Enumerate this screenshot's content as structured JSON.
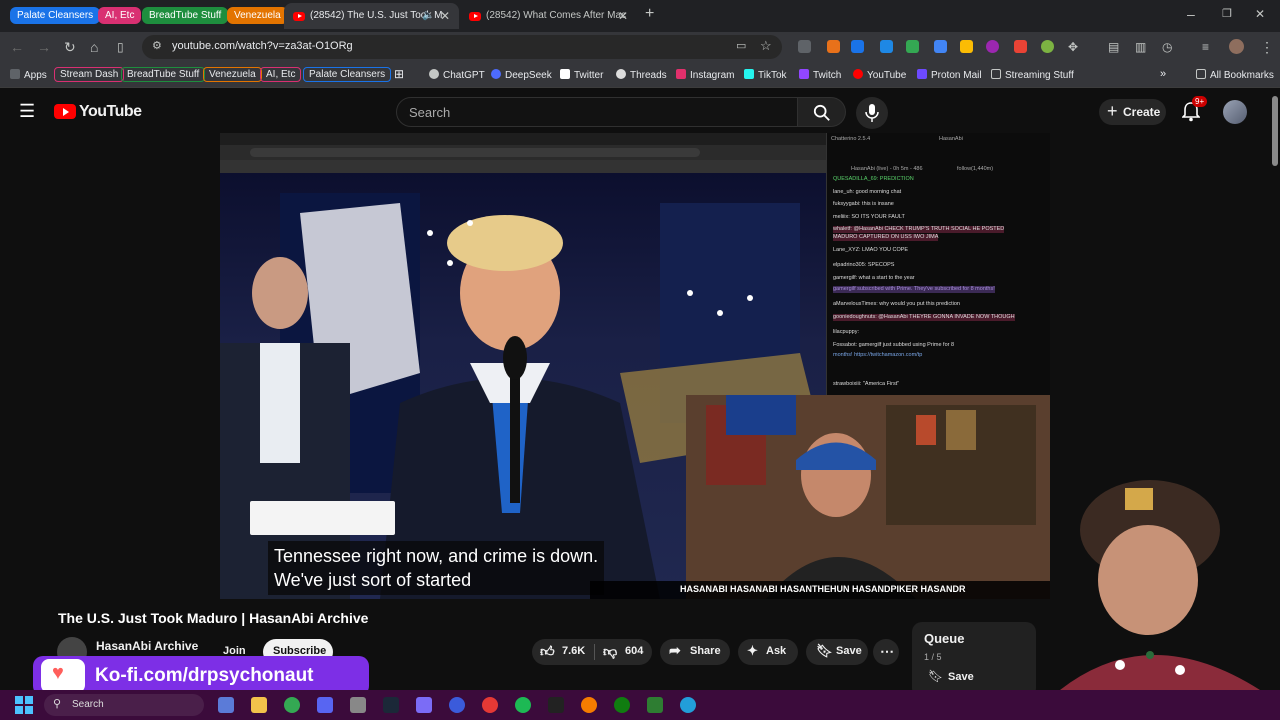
{
  "browser": {
    "tab_groups": [
      {
        "label": "Palate Cleansers",
        "color": "#1a73e8"
      },
      {
        "label": "AI, Etc",
        "color": "#d93072"
      },
      {
        "label": "BreadTube Stuff",
        "color": "#1e8e3e"
      },
      {
        "label": "Venezuela",
        "color": "#e37400"
      }
    ],
    "tabs": [
      {
        "title": "(28542) The U.S. Just Took M",
        "active": true
      },
      {
        "title": "(28542) What Comes After Mac",
        "active": false
      }
    ],
    "url": "youtube.com/watch?v=za3at-O1ORg"
  },
  "bookmarks": {
    "apps_label": "Apps",
    "groups": [
      {
        "label": "Stream Dash",
        "color": "#d93072"
      },
      {
        "label": "BreadTube Stuff",
        "color": "#1e8e3e"
      },
      {
        "label": "Venezuela",
        "color": "#e37400"
      },
      {
        "label": "AI, Etc",
        "color": "#d93072"
      },
      {
        "label": "Palate Cleansers",
        "color": "#1a73e8"
      }
    ],
    "items": [
      "ChatGPT",
      "DeepSeek",
      "Twitter",
      "Threads",
      "Instagram",
      "TikTok",
      "Twitch",
      "YouTube",
      "Proton Mail",
      "Streaming Stuff"
    ],
    "all_bookmarks": "All Bookmarks"
  },
  "youtube": {
    "logo_text": "YouTube",
    "search_placeholder": "Search",
    "create_label": "Create",
    "notification_count": "9+"
  },
  "video": {
    "caption_line1": "Tennessee right now, and crime is down.",
    "caption_line2": "We've just sort of started",
    "overlay_handles": "HASANABI  HASANABI  HASANTHEHUN  HASANDPIKER  HASANDR",
    "chatterino": {
      "title": "Chatterino 2.5.4",
      "channel": "HasanAbi",
      "status_line": "HasanAbi (live) - 0h 5m - 486",
      "follow": "follow(1,440m)",
      "messages": [
        "QUESADILLA_69: PREDICTION",
        "lane_uh: good morning chat",
        "fuksyygabi: this is insane",
        "meliiix: SO ITS YOUR FAULT",
        "whaletf: @HasanAbi CHECK TRUMP'S TRUTH SOCIAL HE POSTED",
        "MADURO CAPTURED ON USS IWO JIMA",
        "Lane_XYZ: LMAO YOU COPE",
        "elpadrino305: SPECOPS",
        "gamergilf: what a start to the year",
        "gamergilf subscribed with Prime. They've subscribed for 8 months!",
        "aMarvelousTimes: why would you put this prediction",
        "gooniedoughnuts: @HasanAbi THEYRE GONNA INVADE NOW THOUGH",
        "lilacpuppy:",
        "Fossabot: gamergilf just subbed using Prime for 8",
        "months! https://twitchamazon.com/tp",
        "strawboixiii: \"America First\""
      ]
    }
  },
  "watch": {
    "title": "The U.S. Just Took Maduro | HasanAbi Archive",
    "channel": "HasanAbi Archive",
    "join_label": "Join",
    "subscribe_label": "Subscribe",
    "likes": "7.6K",
    "dislikes": "604",
    "share_label": "Share",
    "ask_label": "Ask",
    "save_label": "Save",
    "queue": {
      "title": "Queue",
      "position": "1 / 5",
      "save_label": "Save"
    }
  },
  "kofi": {
    "text": "Ko-fi.com/drpsychonaut"
  },
  "taskbar": {
    "search_placeholder": "Search"
  }
}
